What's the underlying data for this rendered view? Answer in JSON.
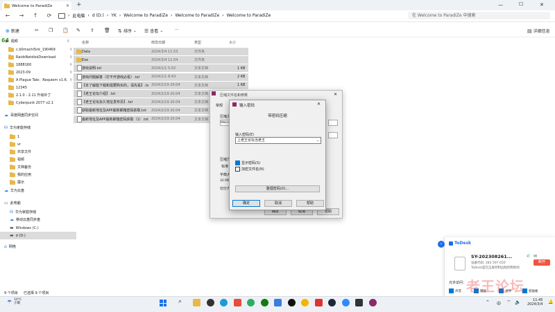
{
  "window": {
    "tab_title": "Welcome to ParadiZe",
    "new_tab": "+",
    "controls": {
      "min": "—",
      "max": "☐",
      "close": "✕"
    }
  },
  "nav": {
    "back": "←",
    "forward": "→",
    "up": "↑",
    "refresh": "⟳"
  },
  "breadcrumbs": [
    "此电脑",
    "d (D:)",
    "YK",
    "Welcome to ParadiZe",
    "Welcome to ParadiZe",
    "Welcome to ParadiZe"
  ],
  "search": {
    "placeholder": "在 Welcome to ParadiZe 中搜索"
  },
  "toolbar": {
    "new_label": "新建",
    "sort_label": "排序",
    "view_label": "查看",
    "more_label": "···",
    "details_label": "详细信息"
  },
  "badge_64": "64",
  "sidebar": {
    "items": [
      {
        "label": "视频",
        "icon": "video-icon",
        "pinned": true
      },
      {
        "label": "c.b0machi5nk_190469",
        "icon": "folder-icon",
        "pinned": true
      },
      {
        "label": "RaidsNetdiskDownload",
        "icon": "folder-icon",
        "pinned": true
      },
      {
        "label": "1888160",
        "icon": "folder-icon",
        "pinned": true
      },
      {
        "label": "2023-09",
        "icon": "folder-icon",
        "pinned": true
      },
      {
        "label": "A Plague Tale：Requiem v1.6.",
        "icon": "folder-icon",
        "pinned": true
      },
      {
        "label": "12345",
        "icon": "folder-icon",
        "pinned": false
      },
      {
        "label": "2.1.0 - 2.11 升级补丁",
        "icon": "folder-icon",
        "pinned": false
      },
      {
        "label": "Cyberpunk 2077 v2.1",
        "icon": "folder-icon",
        "pinned": false
      },
      {
        "label": "百度网盘同步空间",
        "icon": "cloud-icon",
        "pinned": false
      },
      {
        "label": "华为家庭存储",
        "icon": "nas-icon",
        "pinned": false
      },
      {
        "label": "1",
        "icon": "folder-icon",
        "pinned": false
      },
      {
        "label": "vr",
        "icon": "folder-icon",
        "pinned": false
      },
      {
        "label": "共享文件",
        "icon": "folder-icon",
        "pinned": false
      },
      {
        "label": "视频",
        "icon": "folder-icon",
        "pinned": false
      },
      {
        "label": "文档备份",
        "icon": "folder-icon",
        "pinned": false
      },
      {
        "label": "我的应用",
        "icon": "folder-icon",
        "pinned": false
      },
      {
        "label": "展示",
        "icon": "folder-icon",
        "pinned": false
      },
      {
        "label": "华为云盘",
        "icon": "cloud-icon",
        "pinned": false
      },
      {
        "label": "此电脑",
        "icon": "pc-icon",
        "pinned": false
      },
      {
        "label": "华为家庭存储",
        "icon": "nas-icon",
        "pinned": false
      },
      {
        "label": "移动云盘同步盘",
        "icon": "cloud-icon",
        "pinned": false
      },
      {
        "label": "Windows (C:)",
        "icon": "drive-icon",
        "pinned": false
      },
      {
        "label": "d (D:)",
        "icon": "drive-icon",
        "pinned": false
      },
      {
        "label": "网络",
        "icon": "network-icon",
        "pinned": false
      }
    ]
  },
  "columns": {
    "name": "名称",
    "date": "修改日期",
    "type": "类型",
    "size": "大小"
  },
  "files": [
    {
      "name": "Data",
      "date": "2024/3/4 11:53",
      "type": "文件夹",
      "size": "",
      "folder": true
    },
    {
      "name": "Exe",
      "date": "2024/3/4 11:54",
      "type": "文件夹",
      "size": "",
      "folder": true
    },
    {
      "name": "游戏说明.txt",
      "date": "2024/1/1 5:02",
      "type": "文本文档",
      "size": "1 KB",
      "folder": false
    },
    {
      "name": "游戏问题解答（打不开游戏必看）.txt",
      "date": "2024/1/1 8:43",
      "type": "文本文档",
      "size": "2 KB",
      "folder": false
    },
    {
      "name": "【本了解能下载和需要购买的，请先看】.txt",
      "date": "2024/2/19 20:04",
      "type": "文本文档",
      "size": "1 KB",
      "folder": false
    },
    {
      "name": "【老王论坛介绍】.txt",
      "date": "2024/2/19 20:04",
      "type": "文本文档",
      "size": "2 KB",
      "folder": false
    },
    {
      "name": "【老王论坛永久地址发布页】.txt",
      "date": "2024/2/19 20:04",
      "type": "文本文档",
      "size": "",
      "folder": false
    },
    {
      "name": "获取最新地址及APP最新邮箱密码获取.txt",
      "date": "2024/2/19 20:04",
      "type": "文本文档",
      "size": "",
      "folder": false
    },
    {
      "name": "最新地址及APP最新邮箱密码获取（1）.txt",
      "date": "2024/2/19 20:04",
      "type": "文本文档",
      "size": "",
      "folder": false
    }
  ],
  "statusbar": {
    "items": "9 个项目",
    "selected": "已选择 9 个项目"
  },
  "bg_dialog": {
    "title": "压缩文件名和参数",
    "tab": "常规",
    "labels": [
      "压缩文",
      "Welco",
      "压缩方",
      "压缩格",
      "压缩方",
      "标准",
      "字典大",
      "32 MB",
      "切分为"
    ],
    "buttons": {
      "ok": "确定",
      "cancel": "取消",
      "help": "帮助"
    }
  },
  "pw_dialog": {
    "title": "输入密码",
    "group_label": "带密码压缩",
    "prompt": "输入密码(E)",
    "password_value": "上老王论坛当老王",
    "show_password": "显示密码(S)",
    "encrypt_names": "加密文件名(N)",
    "manage_button": "整理密码(O)...",
    "ok": "确定",
    "cancel": "取消",
    "help": "帮助"
  },
  "todesk": {
    "brand": "ToDesk",
    "device_id": "SY-202308261...",
    "device_code_label": "设备代码: 283 597 650",
    "hint": "ToDesk是在正屏控制远程控制你的",
    "action": "断开",
    "allow_label": "允许访问：",
    "perms": [
      "声音",
      "键鼠",
      "文件",
      "剪贴板"
    ]
  },
  "watermark": "老王论坛",
  "taskbar": {
    "weather_temp": "10°C",
    "weather_desc": "小雨",
    "time": "11:45",
    "date": "2024/3/4",
    "lang": "中"
  },
  "colors": {
    "folder": "#e8b84a",
    "selection": "#d8d8d8",
    "accent": "#0078d7",
    "taskbar": "#edf1f6",
    "todesk_blue": "#1e6fe8",
    "disconnect": "#f2553d"
  }
}
